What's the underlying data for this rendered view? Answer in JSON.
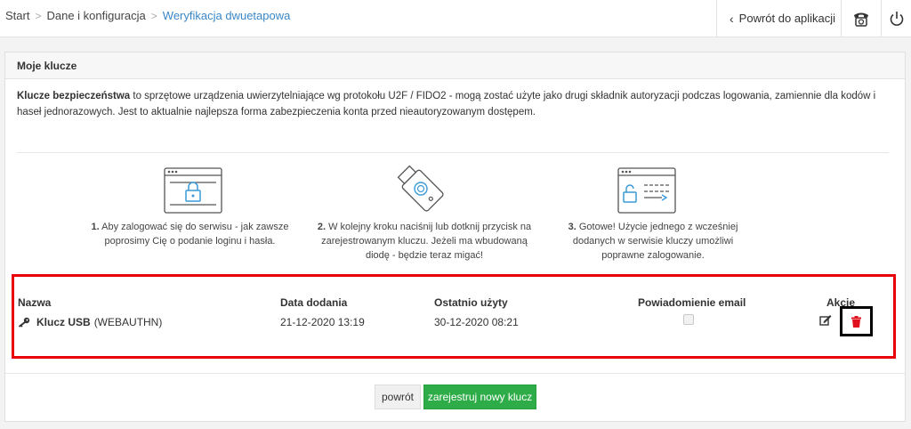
{
  "breadcrumb": {
    "items": [
      "Start",
      "Dane i konfiguracja",
      "Weryfikacja dwuetapowa"
    ],
    "separator": ">"
  },
  "header": {
    "back_label": "Powrót do aplikacji",
    "phone_icon": "phone-icon",
    "power_icon": "power-icon"
  },
  "panel": {
    "title": "Moje klucze",
    "intro_bold": "Klucze bezpieczeństwa",
    "intro_rest": " to sprzętowe urządzenia uwierzytelniające wg protokołu U2F / FIDO2 - mogą zostać użyte jako drugi składnik autoryzacji podczas logowania, zamiennie dla kodów i haseł jednorazowych. Jest to aktualnie najlepsza forma zabezpieczenia konta przed nieautoryzowanym dostępem."
  },
  "steps": [
    {
      "num": "1.",
      "text": " Aby zalogować się do serwisu - jak zawsze poprosimy Cię o podanie loginu i hasła."
    },
    {
      "num": "2.",
      "text": " W kolejny kroku naciśnij lub dotknij przycisk na zarejestrowanym kluczu. Jeżeli ma wbudowaną diodę - będzie teraz migać!"
    },
    {
      "num": "3.",
      "text": " Gotowe! Użycie jednego z wcześniej dodanych w serwisie kluczy umożliwi poprawne zalogowanie."
    }
  ],
  "table": {
    "headers": {
      "name": "Nazwa",
      "added": "Data dodania",
      "last_used": "Ostatnio użyty",
      "email": "Powiadomienie email",
      "actions": "Akcje"
    },
    "rows": [
      {
        "name": "Klucz USB",
        "type": "(WEBAUTHN)",
        "added": "21-12-2020 13:19",
        "last_used": "30-12-2020 08:21",
        "email_notify": false
      }
    ]
  },
  "buttons": {
    "back": "powrót",
    "register": "zarejestruj nowy klucz"
  },
  "colors": {
    "accent_link": "#3a87c8",
    "highlight_red": "#e8000b",
    "delete_red": "#e0101e",
    "success_green": "#2eac48",
    "icon_blue": "#3a9bd8"
  }
}
